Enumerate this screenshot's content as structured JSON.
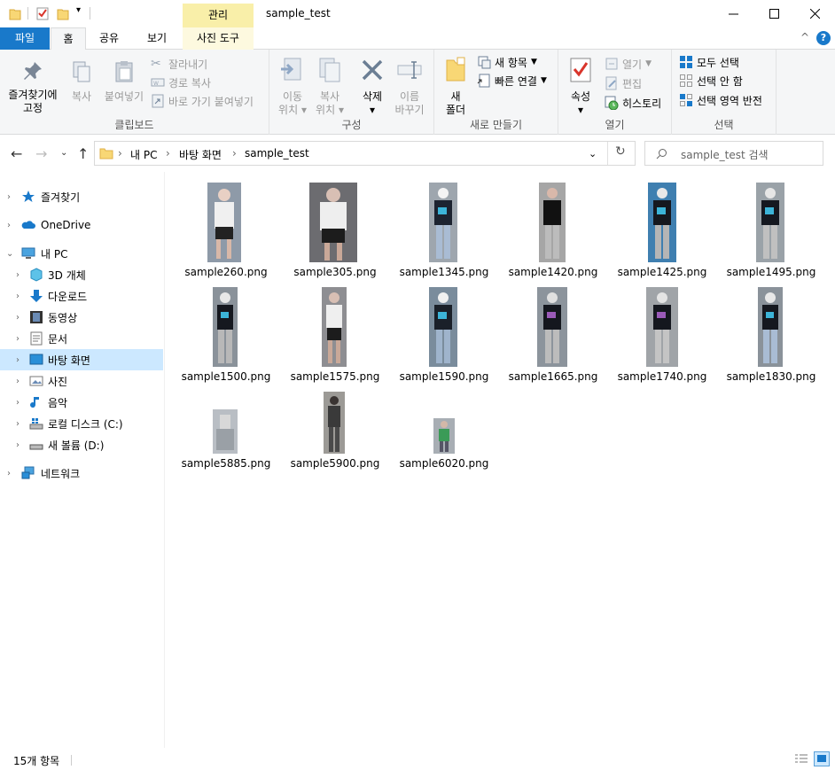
{
  "window": {
    "context_tab": "관리",
    "title": "sample_test"
  },
  "tabs": [
    {
      "label": "파일"
    },
    {
      "label": "홈"
    },
    {
      "label": "공유"
    },
    {
      "label": "보기"
    },
    {
      "label": "사진 도구"
    }
  ],
  "ribbon": {
    "clipboard": {
      "label": "클립보드",
      "pin_line1": "즐겨찾기에",
      "pin_line2": "고정",
      "copy": "복사",
      "paste": "붙여넣기",
      "cut": "잘라내기",
      "copy_path": "경로 복사",
      "paste_shortcut": "바로 가기 붙여넣기"
    },
    "organize": {
      "label": "구성",
      "move_line1": "이동",
      "move_line2": "위치",
      "copyto_line1": "복사",
      "copyto_line2": "위치",
      "delete": "삭제",
      "rename_line1": "이름",
      "rename_line2": "바꾸기"
    },
    "new": {
      "label": "새로 만들기",
      "folder_line1": "새",
      "folder_line2": "폴더",
      "new_item": "새 항목",
      "easy_access": "빠른 연결"
    },
    "open": {
      "label": "열기",
      "properties": "속성",
      "open": "열기",
      "edit": "편집",
      "history": "히스토리"
    },
    "select": {
      "label": "선택",
      "select_all": "모두 선택",
      "select_none": "선택 안 함",
      "invert": "선택 영역 반전"
    }
  },
  "address": {
    "crumbs": [
      "내 PC",
      "바탕 화면",
      "sample_test"
    ],
    "search_placeholder": "sample_test 검색"
  },
  "sidebar": {
    "items": [
      {
        "label": "즐겨찾기"
      },
      {
        "label": "OneDrive"
      },
      {
        "label": "내 PC"
      },
      {
        "label": "3D 개체"
      },
      {
        "label": "다운로드"
      },
      {
        "label": "동영상"
      },
      {
        "label": "문서"
      },
      {
        "label": "바탕 화면"
      },
      {
        "label": "사진"
      },
      {
        "label": "음악"
      },
      {
        "label": "로컬 디스크 (C:)"
      },
      {
        "label": "새 볼륨 (D:)"
      },
      {
        "label": "네트워크"
      }
    ]
  },
  "files": [
    {
      "name": "sample260.png"
    },
    {
      "name": "sample305.png"
    },
    {
      "name": "sample1345.png"
    },
    {
      "name": "sample1420.png"
    },
    {
      "name": "sample1425.png"
    },
    {
      "name": "sample1495.png"
    },
    {
      "name": "sample1500.png"
    },
    {
      "name": "sample1575.png"
    },
    {
      "name": "sample1590.png"
    },
    {
      "name": "sample1665.png"
    },
    {
      "name": "sample1740.png"
    },
    {
      "name": "sample1830.png"
    },
    {
      "name": "sample5885.png"
    },
    {
      "name": "sample5900.png"
    },
    {
      "name": "sample6020.png"
    }
  ],
  "status": {
    "count": "15개 항목"
  },
  "colors": {
    "file_tab": "#1979ca",
    "context_tab": "#f9efa9",
    "selected_nav": "#cce8ff",
    "ribbon_bg": "#f5f6f7"
  }
}
